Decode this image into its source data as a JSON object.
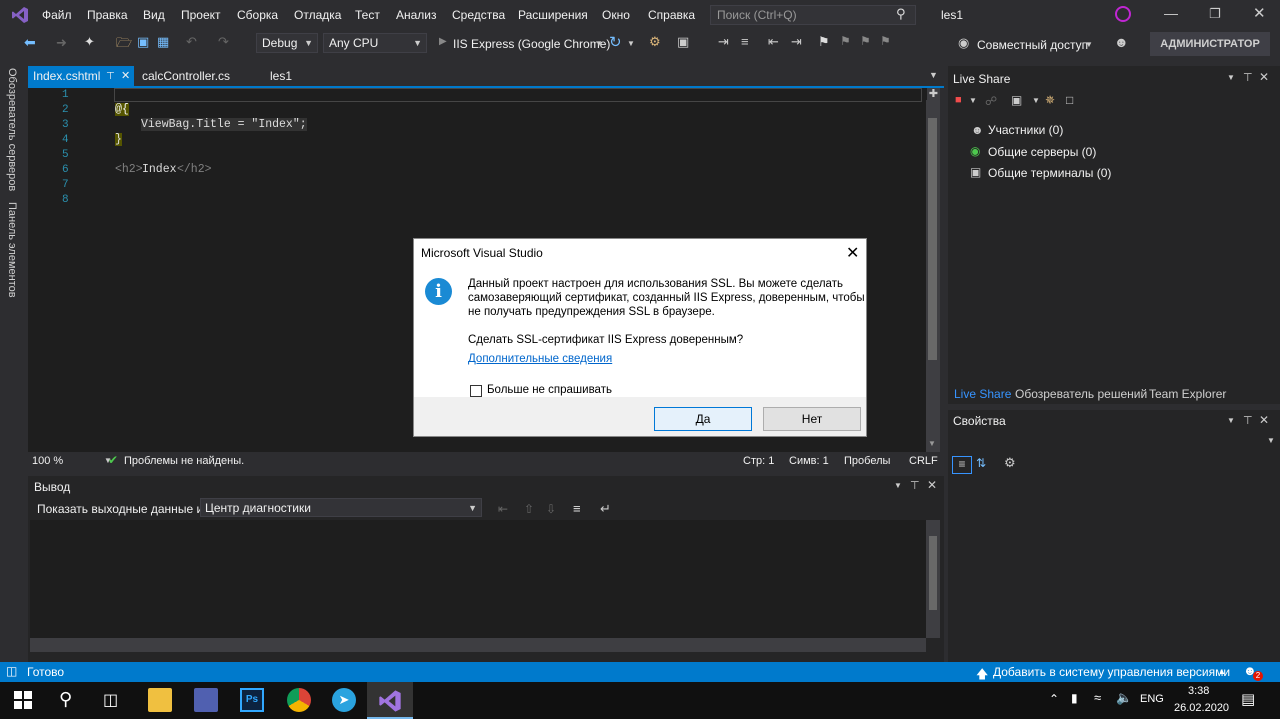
{
  "menu": {
    "items": [
      "Файл",
      "Правка",
      "Вид",
      "Проект",
      "Сборка",
      "Отладка",
      "Тест",
      "Анализ",
      "Средства",
      "Расширения",
      "Окно",
      "Справка"
    ],
    "search_placeholder": "Поиск (Ctrl+Q)",
    "solution_name": "les1",
    "window_controls": [
      "minimize-icon",
      "maximize-icon",
      "close-icon"
    ]
  },
  "toolbar": {
    "config": "Debug",
    "platform": "Any CPU",
    "run_target": "IIS Express (Google Chrome)",
    "share": "Совместный доступ",
    "admin": "АДМИНИСТРАТОР"
  },
  "left_strip": {
    "server_explorer": "Обозреватель серверов",
    "toolbox": "Панель элементов"
  },
  "tabs": [
    {
      "label": "Index.cshtml",
      "active": true
    },
    {
      "label": "calcController.cs",
      "active": false
    },
    {
      "label": "les1",
      "active": false
    }
  ],
  "editor": {
    "line_numbers": [
      "1",
      "2",
      "3",
      "4",
      "5",
      "6",
      "7",
      "8"
    ],
    "code": {
      "l2": "@{",
      "l3": "ViewBag.Title = \"Index\";",
      "l4": "}",
      "l6_open": "<h2>",
      "l6_text": "Index",
      "l6_close": "</h2>"
    }
  },
  "editor_status": {
    "zoom": "100 %",
    "issues": "Проблемы не найдены.",
    "line": "Стр: 1",
    "col": "Симв: 1",
    "spaces": "Пробелы",
    "eol": "CRLF"
  },
  "live_share": {
    "title": "Live Share",
    "items": [
      {
        "label": "Участники (0)",
        "icon": "participants-icon"
      },
      {
        "label": "Общие серверы (0)",
        "icon": "shared-servers-icon"
      },
      {
        "label": "Общие терминалы (0)",
        "icon": "shared-terminals-icon"
      }
    ],
    "bottom_tabs": [
      "Live Share",
      "Обозреватель решений",
      "Team Explorer"
    ]
  },
  "properties": {
    "title": "Свойства"
  },
  "output": {
    "title": "Вывод",
    "show_label": "Показать выходные данные из:",
    "source": "Центр диагностики"
  },
  "status_bar": {
    "ready": "Готово",
    "vcs": "Добавить в систему управления версиями",
    "badge": "2"
  },
  "taskbar": {
    "lang": "ENG",
    "time": "3:38",
    "date": "26.02.2020"
  },
  "dialog": {
    "title": "Microsoft Visual Studio",
    "message_1": "Данный проект настроен для использования SSL. Вы можете сделать",
    "message_2": "самозаверяющий сертификат, созданный IIS Express, доверенным, чтобы",
    "message_3": "не получать предупреждения SSL в браузере.",
    "question": "Сделать SSL-сертификат IIS Express доверенным?",
    "link": "Дополнительные сведения",
    "checkbox": "Больше не спрашивать",
    "yes": "Да",
    "no": "Нет"
  },
  "colors": {
    "accent": "#007acc",
    "background": "#2d2d30",
    "editor_bg": "#1e1e1e"
  }
}
